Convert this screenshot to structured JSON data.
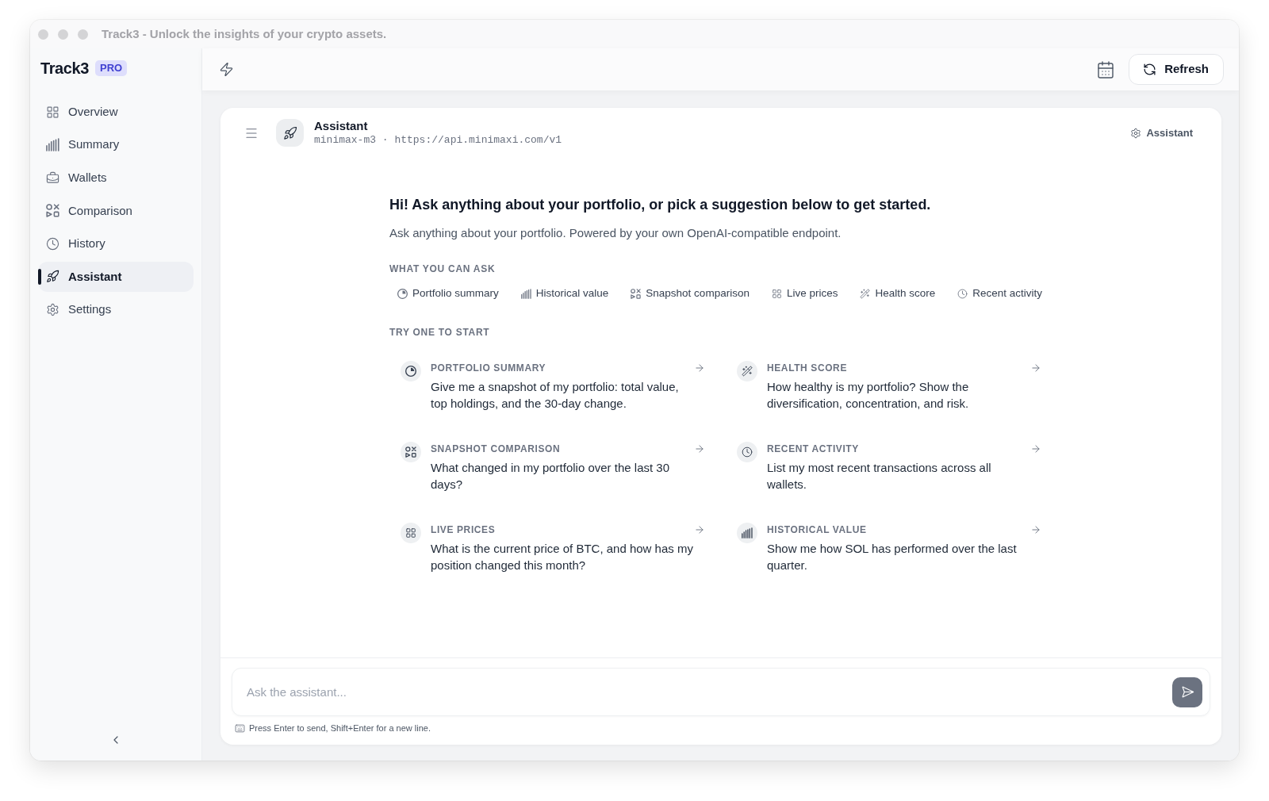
{
  "window": {
    "title": "Track3 - Unlock the insights of your crypto assets."
  },
  "sidebar": {
    "logo": "Track3",
    "badge": "PRO",
    "items": [
      {
        "label": "Overview",
        "kind": "overview",
        "selected": false
      },
      {
        "label": "Summary",
        "kind": "summary",
        "selected": false
      },
      {
        "label": "Wallets",
        "kind": "wallets",
        "selected": false
      },
      {
        "label": "Comparison",
        "kind": "comparison",
        "selected": false
      },
      {
        "label": "History",
        "kind": "history",
        "selected": false
      },
      {
        "label": "Assistant",
        "kind": "assistant",
        "selected": true
      },
      {
        "label": "Settings",
        "kind": "settings",
        "selected": false
      }
    ]
  },
  "toolbar": {
    "refresh_button": "Refresh"
  },
  "assistant_panel": {
    "title": "Assistant",
    "subtitle": "minimax-m3 · https://api.minimaxi.com/v1",
    "settings_link": "Assistant",
    "heading": "Hi! Ask anything about your portfolio, or pick a suggestion below to get started.",
    "intro": "Ask anything about your portfolio. Powered by your own OpenAI-compatible endpoint.",
    "capabilities": {
      "label": "WHAT YOU CAN ASK",
      "items": [
        {
          "label": "Portfolio summary",
          "kind": "portfolio"
        },
        {
          "label": "Historical value",
          "kind": "historical"
        },
        {
          "label": "Snapshot comparison",
          "kind": "comparison"
        },
        {
          "label": "Live prices",
          "kind": "prices"
        },
        {
          "label": "Health score",
          "kind": "health"
        },
        {
          "label": "Recent activity",
          "kind": "activity"
        }
      ]
    },
    "suggestions": {
      "label": "TRY ONE TO START",
      "items": [
        {
          "kind": "portfolio",
          "title": "PORTFOLIO SUMMARY",
          "prompt": "Give me a snapshot of my portfolio: total value, top holdings, and the 30-day change."
        },
        {
          "kind": "health",
          "title": "HEALTH SCORE",
          "prompt": "How healthy is my portfolio? Show the diversification, concentration, and risk."
        },
        {
          "kind": "comparison",
          "title": "SNAPSHOT COMPARISON",
          "prompt": "What changed in my portfolio over the last 30 days?"
        },
        {
          "kind": "activity",
          "title": "RECENT ACTIVITY",
          "prompt": "List my most recent transactions across all wallets."
        },
        {
          "kind": "prices",
          "title": "LIVE PRICES",
          "prompt": "What is the current price of BTC, and how has my position changed this month?"
        },
        {
          "kind": "historical",
          "title": "HISTORICAL VALUE",
          "prompt": "Show me how SOL has performed over the last quarter."
        }
      ]
    },
    "composer": {
      "placeholder": "Ask the assistant...",
      "hint": "Press Enter to send, Shift+Enter for a new line."
    }
  }
}
